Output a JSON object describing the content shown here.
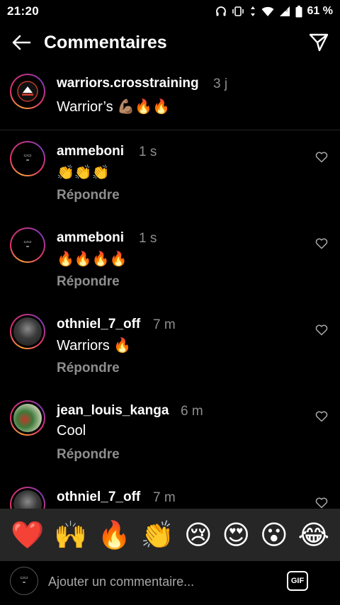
{
  "status_bar": {
    "time": "21:20",
    "battery_percent": "61 %",
    "icons": [
      "headphones-icon",
      "vibrate-icon",
      "data-arrows-icon",
      "wifi-icon",
      "signal-icon",
      "battery-icon"
    ]
  },
  "header": {
    "title": "Commentaires",
    "back_icon": "arrow-left-icon",
    "send_icon": "paper-plane-icon"
  },
  "caption": {
    "username": "warriors.crosstraining",
    "time": "3 j",
    "text": "Warrior’s 💪🏽🔥🔥"
  },
  "comments": [
    {
      "username": "ammeboni",
      "time": "1 s",
      "text": "👏👏👏",
      "reply_label": "Répondre"
    },
    {
      "username": "ammeboni",
      "time": "1 s",
      "text": "🔥🔥🔥🔥",
      "reply_label": "Répondre"
    },
    {
      "username": "othniel_7_off",
      "time": "7 m",
      "text": "Warriors 🔥",
      "reply_label": "Répondre"
    },
    {
      "username": "jean_louis_kanga",
      "time": "6 m",
      "text": "Cool",
      "reply_label": "Répondre"
    },
    {
      "username": "othniel_7_off",
      "time": "7 m",
      "text": "",
      "reply_label": ""
    }
  ],
  "emoji_bar": [
    "❤️",
    "🙌",
    "🔥",
    "👏",
    "😢",
    "😍",
    "😮",
    "😂"
  ],
  "input": {
    "placeholder": "Ajouter un commentaire...",
    "gif_label": "GIF"
  },
  "colors": {
    "background": "#000000",
    "muted_text": "#8e8e8e",
    "emoji_bar_bg": "#262626"
  }
}
